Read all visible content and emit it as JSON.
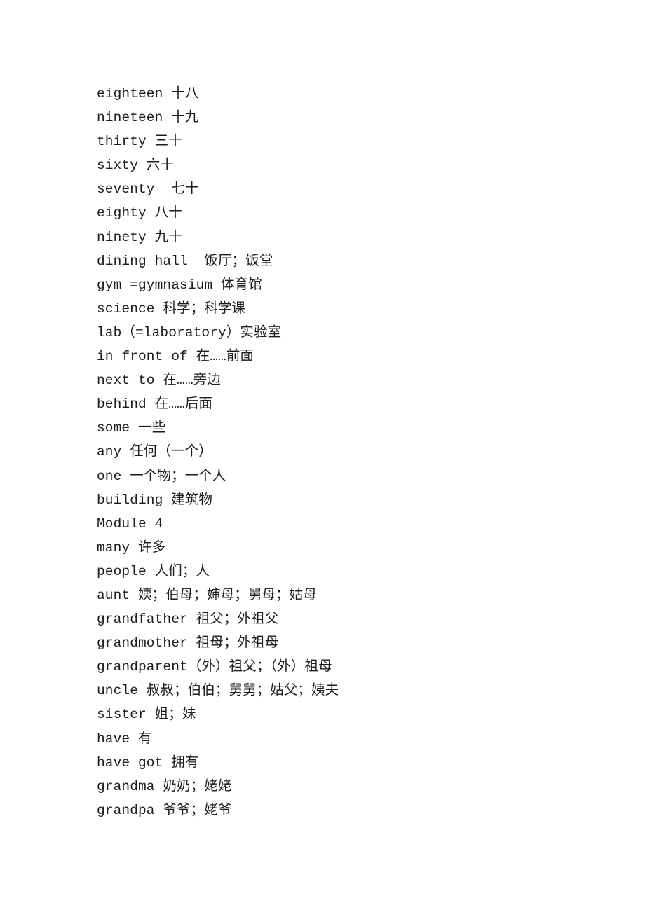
{
  "document": {
    "type": "vocabulary-word-list",
    "language_pair": "English-Chinese",
    "text_color": "#1c1c1c",
    "background_color": "#ffffff",
    "entries": [
      {
        "term": "eighteen",
        "gloss": "十八",
        "line": "eighteen 十八"
      },
      {
        "term": "nineteen",
        "gloss": "十九",
        "line": "nineteen 十九"
      },
      {
        "term": "thirty",
        "gloss": "三十",
        "line": "thirty 三十"
      },
      {
        "term": "sixty",
        "gloss": "六十",
        "line": "sixty 六十"
      },
      {
        "term": "seventy",
        "gloss": "七十",
        "line": "seventy  七十"
      },
      {
        "term": "eighty",
        "gloss": "八十",
        "line": "eighty 八十"
      },
      {
        "term": "ninety",
        "gloss": "九十",
        "line": "ninety 九十"
      },
      {
        "term": "dining hall",
        "gloss": "饭厅；饭堂",
        "line": "dining hall  饭厅；饭堂"
      },
      {
        "term": "gym =gymnasium",
        "gloss": "体育馆",
        "line": "gym =gymnasium 体育馆"
      },
      {
        "term": "science",
        "gloss": "科学；科学课",
        "line": "science 科学；科学课"
      },
      {
        "term": "lab（=laboratory）",
        "gloss": "实验室",
        "line": "lab（=laboratory）实验室"
      },
      {
        "term": "in front of",
        "gloss": "在……前面",
        "line": "in front of 在……前面"
      },
      {
        "term": "next to",
        "gloss": "在……旁边",
        "line": "next to 在……旁边"
      },
      {
        "term": "behind",
        "gloss": "在……后面",
        "line": "behind 在……后面"
      },
      {
        "term": "some",
        "gloss": "一些",
        "line": "some 一些"
      },
      {
        "term": "any",
        "gloss": "任何（一个）",
        "line": "any 任何（一个）"
      },
      {
        "term": "one",
        "gloss": "一个物；一个人",
        "line": "one 一个物；一个人"
      },
      {
        "term": "building",
        "gloss": "建筑物",
        "line": "building 建筑物"
      },
      {
        "term": "Module 4",
        "gloss": "",
        "line": "Module 4"
      },
      {
        "term": "many",
        "gloss": "许多",
        "line": "many 许多"
      },
      {
        "term": "people",
        "gloss": "人们；人",
        "line": "people 人们；人"
      },
      {
        "term": "aunt",
        "gloss": "姨；伯母；婶母；舅母；姑母",
        "line": "aunt 姨；伯母；婶母；舅母；姑母"
      },
      {
        "term": "grandfather",
        "gloss": "祖父；外祖父",
        "line": "grandfather 祖父；外祖父"
      },
      {
        "term": "grandmother",
        "gloss": "祖母；外祖母",
        "line": "grandmother 祖母；外祖母"
      },
      {
        "term": "grandparent",
        "gloss": "（外）祖父；（外）祖母",
        "line": "grandparent（外）祖父；（外）祖母"
      },
      {
        "term": "uncle",
        "gloss": "叔叔；伯伯；舅舅；姑父；姨夫",
        "line": "uncle 叔叔；伯伯；舅舅；姑父；姨夫"
      },
      {
        "term": "sister",
        "gloss": "姐；妹",
        "line": "sister 姐；妹"
      },
      {
        "term": "have",
        "gloss": "有",
        "line": "have 有"
      },
      {
        "term": "have got",
        "gloss": "拥有",
        "line": "have got 拥有"
      },
      {
        "term": "grandma",
        "gloss": "奶奶；姥姥",
        "line": "grandma 奶奶；姥姥"
      },
      {
        "term": "grandpa",
        "gloss": "爷爷；姥爷",
        "line": "grandpa 爷爷；姥爷"
      }
    ]
  }
}
